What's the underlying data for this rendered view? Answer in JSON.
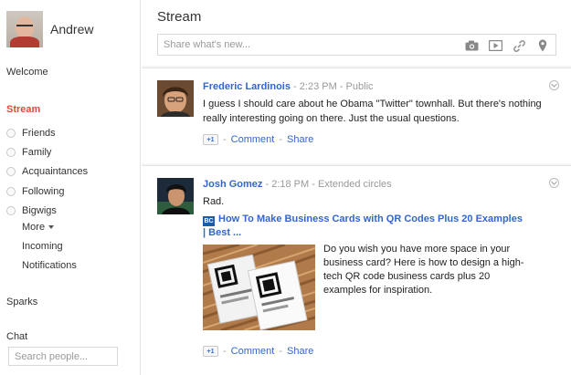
{
  "profile": {
    "name": "Andrew"
  },
  "nav": {
    "welcome": "Welcome",
    "stream": "Stream",
    "circles": [
      "Friends",
      "Family",
      "Acquaintances",
      "Following",
      "Bigwigs"
    ],
    "more": "More",
    "incoming": "Incoming",
    "notifications": "Notifications",
    "sparks": "Sparks",
    "chat": "Chat"
  },
  "chat": {
    "search_placeholder": "Search people..."
  },
  "stream": {
    "title": "Stream",
    "share_placeholder": "Share what's new...",
    "share_icons": [
      "camera-icon",
      "video-icon",
      "link-icon",
      "location-pin-icon"
    ]
  },
  "posts": [
    {
      "author": "Frederic Lardinois",
      "separator": "-",
      "time": "2:23 PM",
      "visibility": "Public",
      "text": "I guess I should care about he Obama \"Twitter\" townhall. But there's nothing really interesting going on there. Just the usual questions.",
      "plus_one": "+1",
      "comment": "Comment",
      "share": "Share"
    },
    {
      "author": "Josh Gomez",
      "separator": "-",
      "time": "2:18 PM",
      "visibility": "Extended circles",
      "text": "Rad.",
      "link_favicon": "BC",
      "link_title": "How To Make Business Cards with QR Codes Plus 20 Examples | Best ...",
      "link_description": "Do you wish you have more space in your business card? Here is how to design a high-tech QR code business cards plus 20 examples for inspiration.",
      "plus_one": "+1",
      "comment": "Comment",
      "share": "Share"
    }
  ],
  "colors": {
    "accent_red": "#dd4b39",
    "link_blue": "#3366cc",
    "meta_gray": "#999999"
  }
}
